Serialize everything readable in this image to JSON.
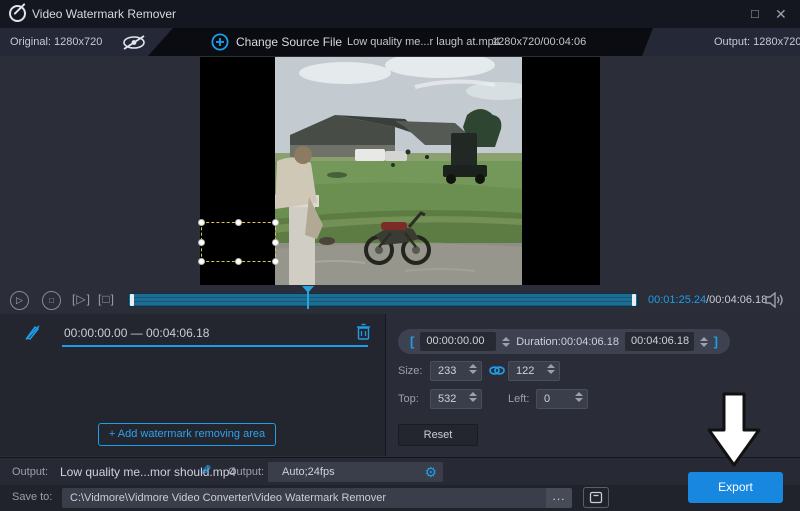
{
  "titlebar": {
    "title": "Video Watermark Remover",
    "maximize_glyph": "□",
    "close_glyph": "✕"
  },
  "toolbar": {
    "original_label": "Original: 1280x720",
    "change_source_label": "Change Source File",
    "file_name": "Low quality me...r laugh at.mp4",
    "file_meta": "1280x720/00:04:06",
    "output_label": "Output: 1280x720"
  },
  "transport": {
    "current_time": "00:01:25.24",
    "total_time": "/00:04:06.18"
  },
  "watermark_track": {
    "range": "00:00:00.00 — 00:04:06.18",
    "add_area_plus": "+",
    "add_area_label": "Add watermark removing area"
  },
  "properties": {
    "bracket_open": "[",
    "bracket_close": "]",
    "start_time": "00:00:00.00",
    "duration_label": "Duration:00:04:06.18",
    "end_time": "00:04:06.18",
    "size_label": "Size:",
    "size_width": "233",
    "size_height": "122",
    "top_label": "Top:",
    "top_value": "532",
    "left_label": "Left:",
    "left_value": "0",
    "reset_label": "Reset"
  },
  "output_row": {
    "output_label": "Output:",
    "file_name": "Low quality me...mor should.mp4",
    "format_label": "Output:",
    "format_value": "Auto;24fps",
    "export_label": "Export"
  },
  "save_row": {
    "save_to_label": "Save to:",
    "path": "C:\\Vidmore\\Vidmore Video Converter\\Video Watermark Remover",
    "browse_label": "..."
  },
  "colors": {
    "accent_blue": "#1e9de8",
    "export_blue": "#1787e0",
    "timeline_fill": "#1d6e94",
    "selection_yellow": "#d9c94f"
  }
}
